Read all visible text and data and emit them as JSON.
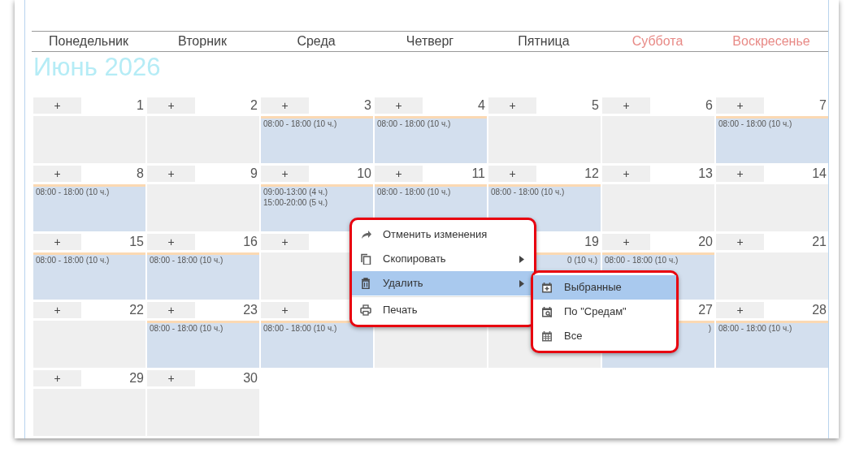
{
  "weekdays": [
    {
      "label": "Понедельник",
      "weekend": false
    },
    {
      "label": "Вторник",
      "weekend": false
    },
    {
      "label": "Среда",
      "weekend": false
    },
    {
      "label": "Четверг",
      "weekend": false
    },
    {
      "label": "Пятница",
      "weekend": false
    },
    {
      "label": "Суббота",
      "weekend": true
    },
    {
      "label": "Воскресенье",
      "weekend": true
    }
  ],
  "month_title": "Июнь 2026",
  "weeks": [
    [
      {
        "kind": "free",
        "plus": "+",
        "number": "1"
      },
      {
        "kind": "free",
        "plus": "+",
        "number": "2"
      },
      {
        "kind": "shift",
        "plus": "+",
        "number": "3",
        "events": [
          {
            "text": "08:00 - 18:00 (10 ч.)"
          }
        ]
      },
      {
        "kind": "shift",
        "plus": "+",
        "number": "4",
        "events": [
          {
            "text": "08:00 - 18:00 (10 ч.)"
          }
        ]
      },
      {
        "kind": "free",
        "plus": "+",
        "number": "5"
      },
      {
        "kind": "free",
        "plus": "+",
        "number": "6"
      },
      {
        "kind": "shift",
        "plus": "+",
        "number": "7",
        "events": [
          {
            "text": "08:00 - 18:00 (10 ч.)"
          }
        ]
      }
    ],
    [
      {
        "kind": "shift",
        "plus": "+",
        "number": "8",
        "events": [
          {
            "text": "08:00 - 18:00 (10 ч.)"
          }
        ]
      },
      {
        "kind": "free",
        "plus": "+",
        "number": "9"
      },
      {
        "kind": "shift",
        "plus": "+",
        "number": "10",
        "events": [
          {
            "text": "09:00-13:00 (4 ч.)"
          },
          {
            "text": "15:00-20:00 (5 ч.)"
          }
        ]
      },
      {
        "kind": "shift",
        "plus": "+",
        "number": "11",
        "events": [
          {
            "text": "08:00 - 18:00 (10 ч.)"
          }
        ]
      },
      {
        "kind": "shift",
        "plus": "+",
        "number": "12",
        "events": [
          {
            "text": "08:00 - 18:00 (10 ч.)"
          }
        ]
      },
      {
        "kind": "free",
        "plus": "+",
        "number": "13"
      },
      {
        "kind": "free",
        "plus": "+",
        "number": "14"
      }
    ],
    [
      {
        "kind": "shift",
        "plus": "+",
        "number": "15",
        "events": [
          {
            "text": "08:00 - 18:00 (10 ч.)"
          }
        ]
      },
      {
        "kind": "shift",
        "plus": "+",
        "number": "16",
        "events": [
          {
            "text": "08:00 - 18:00 (10 ч.)"
          }
        ]
      },
      {
        "kind": "free",
        "plus": "+"
      },
      {
        "kind": "covered"
      },
      {
        "kind": "shift",
        "number": "19",
        "events": [
          {
            "text": "0 (10 ч.)",
            "clipped": true
          }
        ]
      },
      {
        "kind": "shift",
        "plus": "+",
        "number": "20",
        "events": [
          {
            "text": "08:00 - 18:00 (10 ч.)"
          }
        ]
      },
      {
        "kind": "free",
        "plus": "+",
        "number": "21"
      }
    ],
    [
      {
        "kind": "free",
        "plus": "+",
        "number": "22"
      },
      {
        "kind": "shift",
        "plus": "+",
        "number": "23",
        "events": [
          {
            "text": "08:00 - 18:00 (10 ч.)"
          }
        ]
      },
      {
        "kind": "shift",
        "plus": "+",
        "events": [
          {
            "text": "08:00 - 18:00 (10 ч.)"
          }
        ]
      },
      {
        "kind": "free"
      },
      {
        "kind": "free"
      },
      {
        "kind": "shift",
        "number": "27",
        "events": [
          {
            "text": ")",
            "clipped": true
          }
        ]
      },
      {
        "kind": "shift",
        "plus": "+",
        "number": "28",
        "events": [
          {
            "text": "08:00 - 18:00 (10 ч.)"
          }
        ]
      }
    ],
    [
      {
        "kind": "free",
        "plus": "+",
        "number": "29"
      },
      {
        "kind": "free",
        "plus": "+",
        "number": "30"
      }
    ]
  ],
  "context_menu": {
    "annotated": true,
    "items": [
      {
        "kind": "undo",
        "label": "Отменить изменения",
        "selected": false
      },
      {
        "kind": "copy",
        "label": "Скопировать",
        "submenu": true,
        "selected": false
      },
      {
        "kind": "delete",
        "label": "Удалить",
        "submenu": true,
        "selected": true
      },
      {
        "kind": "print",
        "label": "Печать",
        "selected": false,
        "divider_before": true
      }
    ]
  },
  "submenu": {
    "annotated": true,
    "items": [
      {
        "kind": "selected-days",
        "label": "Выбранные",
        "selected": true
      },
      {
        "kind": "weekday",
        "label": "По \"Средам\"",
        "selected": false
      },
      {
        "kind": "all",
        "label": "Все",
        "selected": false
      }
    ]
  }
}
